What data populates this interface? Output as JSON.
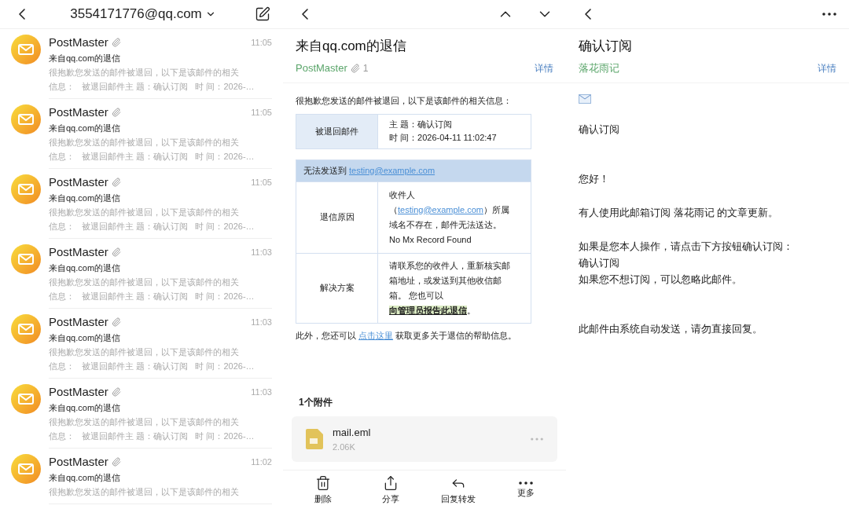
{
  "inbox": {
    "account": "3554171776@qq.com",
    "messages": [
      {
        "sender": "PostMaster",
        "time": "11:05",
        "subject": "来自qq.com的退信",
        "preview": [
          "很抱歉您发送的邮件被退回，以下是该邮件的相关",
          "信息：   被退回邮件主 题：确认订阅   时 间：2026-…"
        ]
      },
      {
        "sender": "PostMaster",
        "time": "11:05",
        "subject": "来自qq.com的退信",
        "preview": [
          "很抱歉您发送的邮件被退回，以下是该邮件的相关",
          "信息：   被退回邮件主 题：确认订阅   时 间：2026-…"
        ]
      },
      {
        "sender": "PostMaster",
        "time": "11:05",
        "subject": "来自qq.com的退信",
        "preview": [
          "很抱歉您发送的邮件被退回，以下是该邮件的相关",
          "信息：   被退回邮件主 题：确认订阅   时 间：2026-…"
        ]
      },
      {
        "sender": "PostMaster",
        "time": "11:03",
        "subject": "来自qq.com的退信",
        "preview": [
          "很抱歉您发送的邮件被退回，以下是该邮件的相关",
          "信息：   被退回邮件主 题：确认订阅   时 间：2026-…"
        ]
      },
      {
        "sender": "PostMaster",
        "time": "11:03",
        "subject": "来自qq.com的退信",
        "preview": [
          "很抱歉您发送的邮件被退回，以下是该邮件的相关",
          "信息：   被退回邮件主 题：确认订阅   时 间：2026-…"
        ]
      },
      {
        "sender": "PostMaster",
        "time": "11:03",
        "subject": "来自qq.com的退信",
        "preview": [
          "很抱歉您发送的邮件被退回，以下是该邮件的相关",
          "信息：   被退回邮件主 题：确认订阅   时 间：2026-…"
        ]
      },
      {
        "sender": "PostMaster",
        "time": "11:02",
        "subject": "来自qq.com的退信",
        "preview": [
          "很抱歉您发送的邮件被退回，以下是该邮件的相关"
        ]
      }
    ]
  },
  "bounce": {
    "title": "来自qq.com的退信",
    "sender": "PostMaster",
    "attachment_count": "1",
    "details": "详情",
    "intro": "很抱歉您发送的邮件被退回，以下是该邮件的相关信息：",
    "returned": {
      "label": "被退回邮件",
      "subject": "主 题：确认订阅",
      "time": "时 间：2026-04-11 11:02:47"
    },
    "failure": {
      "header": "无法发送到",
      "header_email": "testing@example.com",
      "reason_label": "退信原因",
      "reason_before": "收件人（",
      "reason_email": "testing@example.com",
      "reason_after": "）所属域名不存在，邮件无法送达。",
      "reason_code": "No Mx Record Found",
      "solution_label": "解决方案",
      "solution": "请联系您的收件人，重新核实邮箱地址，或发送到其他收信邮箱。 您也可以",
      "solution_link": "向管理员报告此退信",
      "solution_end": "。"
    },
    "footer_before": "此外，您还可以 ",
    "footer_link": "点击这里",
    "footer_after": " 获取更多关于退信的帮助信息。",
    "attachments_heading": "1个附件",
    "attachment": {
      "name": "mail.eml",
      "size": "2.06K"
    },
    "toolbar": [
      {
        "kind": "delete",
        "label": "删除"
      },
      {
        "kind": "share",
        "label": "分享"
      },
      {
        "kind": "reply",
        "label": "回复转发"
      },
      {
        "kind": "more",
        "label": "更多"
      }
    ]
  },
  "subscription": {
    "title": "确认订阅",
    "sender": "落花雨记",
    "details": "详情",
    "paragraphs": [
      [
        "确认订阅"
      ],
      [
        "您好！"
      ],
      [
        "有人使用此邮箱订阅 落花雨记 的文章更新。"
      ],
      [
        "如果是您本人操作，请点击下方按钮确认订阅：",
        "确认订阅",
        "如果您不想订阅，可以忽略此邮件。"
      ],
      [
        "此邮件由系统自动发送，请勿直接回复。"
      ]
    ]
  }
}
